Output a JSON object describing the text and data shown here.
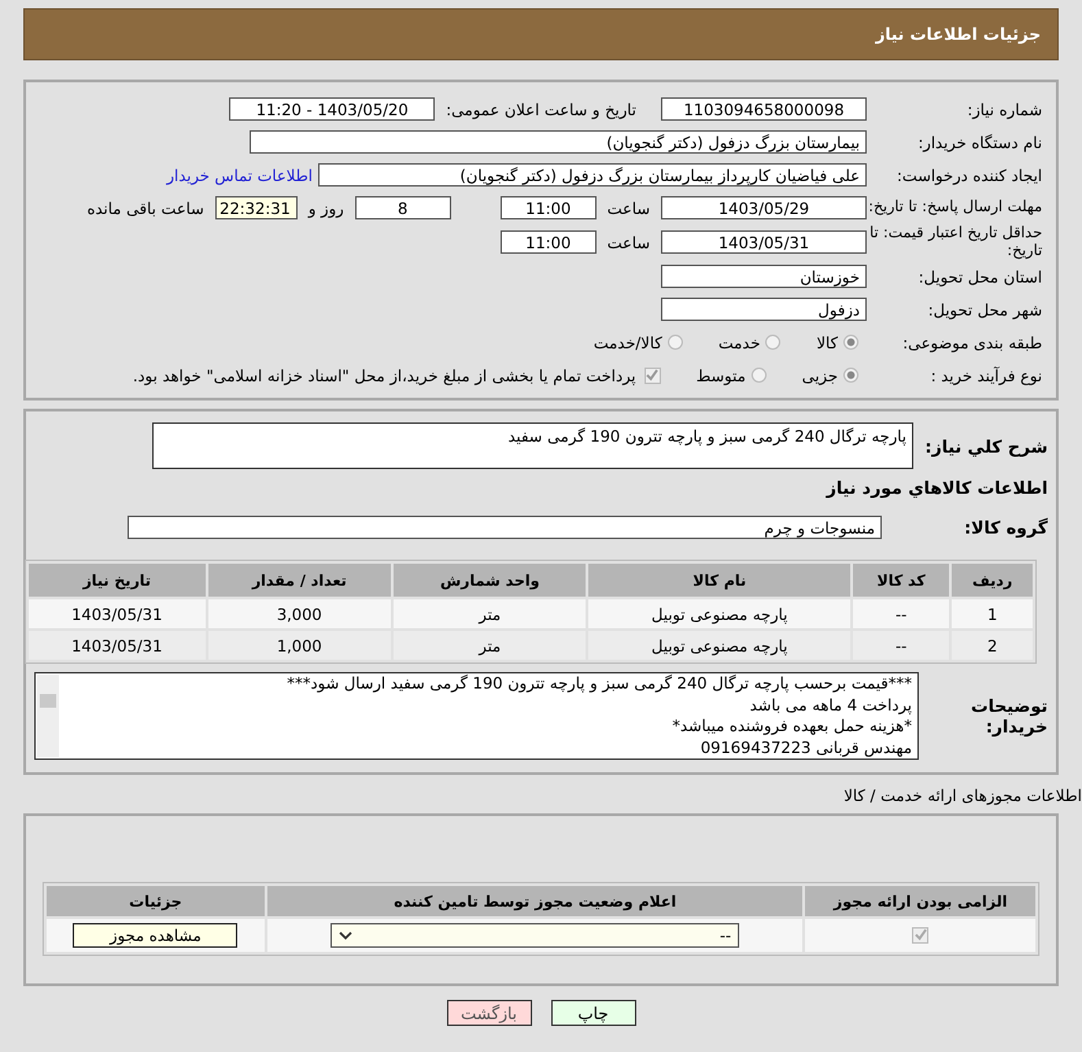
{
  "header": {
    "title": "جزئیات اطلاعات نیاز"
  },
  "form": {
    "need_number": {
      "label": "شماره نیاز:",
      "value": "1103094658000098"
    },
    "announce": {
      "label": "تاریخ و ساعت اعلان عمومی:",
      "value": "1403/05/20 - 11:20"
    },
    "buyer": {
      "label": "نام دستگاه خریدار:",
      "value": "بیمارستان بزرگ دزفول (دکتر گنجویان)"
    },
    "creator": {
      "label": "ایجاد کننده درخواست:",
      "value": "علی فیاضیان کارپرداز بیمارستان بزرگ دزفول (دکتر گنجویان)",
      "link": "اطلاعات تماس خریدار"
    },
    "reply_deadline": {
      "label": "مهلت ارسال پاسخ: تا تاریخ:",
      "date": "1403/05/29",
      "time_label": "ساعت",
      "time": "11:00",
      "days": "8",
      "days_label": "روز و",
      "remaining": "22:32:31",
      "remaining_label": "ساعت باقی مانده"
    },
    "validity": {
      "label": "حداقل تاریخ اعتبار قیمت: تا تاریخ:",
      "date": "1403/05/31",
      "time_label": "ساعت",
      "time": "11:00"
    },
    "province": {
      "label": "استان محل تحویل:",
      "value": "خوزستان"
    },
    "city": {
      "label": "شهر محل تحویل:",
      "value": "دزفول"
    },
    "category": {
      "label": "طبقه بندی موضوعی:",
      "options": [
        {
          "label": "کالا",
          "selected": true
        },
        {
          "label": "خدمت",
          "selected": false
        },
        {
          "label": "کالا/خدمت",
          "selected": false
        }
      ]
    },
    "process": {
      "label": "نوع فرآیند خرید :",
      "options": [
        {
          "label": "جزیی",
          "selected": true
        },
        {
          "label": "متوسط",
          "selected": false
        }
      ],
      "payment": {
        "checked": true,
        "label": "پرداخت تمام یا بخشی از مبلغ خرید،از محل \"اسناد خزانه اسلامی\" خواهد بود."
      }
    }
  },
  "description": {
    "label": "شرح کلي نياز:",
    "value": "پارچه ترگال 240 گرمی سبز و پارچه تترون 190 گرمی سفید"
  },
  "goods_title": "اطلاعات کالاهاي مورد نياز",
  "goods_group": {
    "label": "گروه کالا:",
    "value": "منسوجات و چرم"
  },
  "goods_table": {
    "columns": [
      "ردیف",
      "کد کالا",
      "نام کالا",
      "واحد شمارش",
      "تعداد / مقدار",
      "تاریخ نیاز"
    ],
    "rows": [
      [
        "1",
        "--",
        "پارچه مصنوعی توبیل",
        "متر",
        "3,000",
        "1403/05/31"
      ],
      [
        "2",
        "--",
        "پارچه مصنوعی توبیل",
        "متر",
        "1,000",
        "1403/05/31"
      ]
    ]
  },
  "buyer_notes": {
    "label": "توضیحات خریدار:",
    "lines": [
      "***قیمت برحسب پارچه ترگال 240 گرمی سبز و پارچه تترون 190 گرمی سفید ارسال شود***",
      "پرداخت 4 ماهه می باشد",
      "*هزینه حمل بعهده فروشنده میباشد*",
      "مهندس قربانی 09169437223"
    ]
  },
  "permits_title": "اطلاعات مجوزهای ارائه خدمت / کالا",
  "permits_table": {
    "columns": [
      "الزامی بودن ارائه مجوز",
      "اعلام وضعیت مجوز توسط تامین کننده",
      "جزئیات"
    ],
    "rows": [
      {
        "required": true,
        "status": "--",
        "details": "مشاهده مجوز"
      }
    ]
  },
  "buttons": [
    {
      "label": "چاپ",
      "kind": "print"
    },
    {
      "label": "بازگشت",
      "kind": "back"
    }
  ]
}
